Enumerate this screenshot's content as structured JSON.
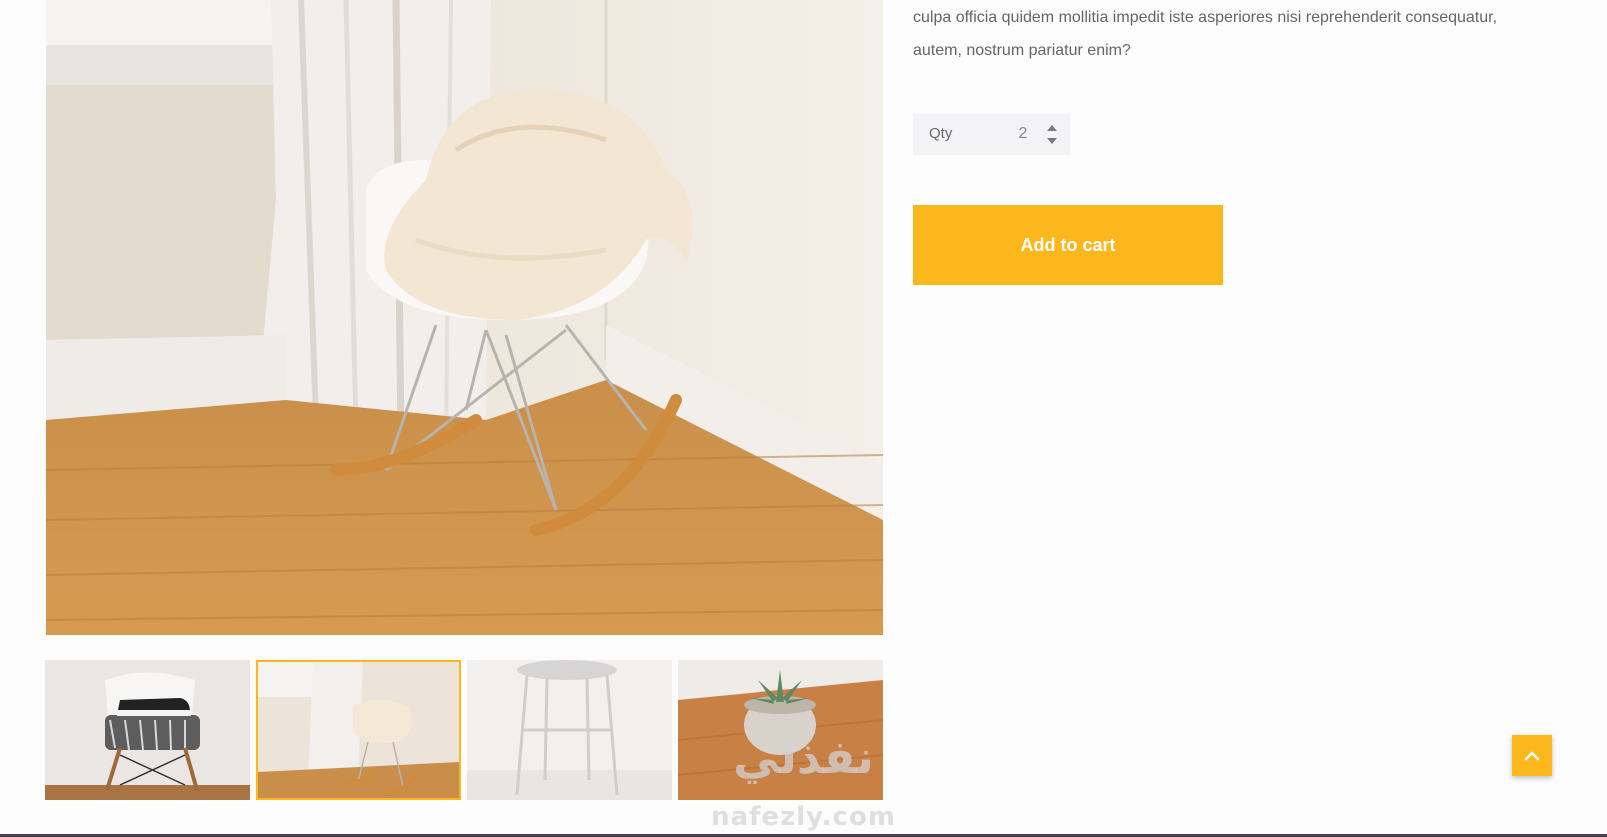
{
  "product": {
    "description": "culpa officia quidem mollitia impedit iste asperiores nisi reprehenderit consequatur, autem, nostrum pariatur enim?",
    "main_image_icon": "rocking-chair-photo",
    "thumbnails": [
      {
        "icon": "chair-with-sneakers-photo",
        "active": false
      },
      {
        "icon": "rocking-chair-photo",
        "active": true
      },
      {
        "icon": "white-stool-photo",
        "active": false
      },
      {
        "icon": "succulent-pot-photo",
        "active": false
      }
    ]
  },
  "quantity": {
    "label": "Qty",
    "value": "2",
    "increment_icon": "caret-up-icon",
    "decrement_icon": "caret-down-icon"
  },
  "cart": {
    "add_label": "Add to cart"
  },
  "back_to_top": {
    "icon": "chevron-up-icon"
  },
  "watermark": {
    "arabic": "نفذلي",
    "latin": "nafezly.com"
  },
  "colors": {
    "accent": "#fbb71b",
    "text": "#666666",
    "qty_bg": "#f3f2f4",
    "footer": "#4a3e4e"
  }
}
